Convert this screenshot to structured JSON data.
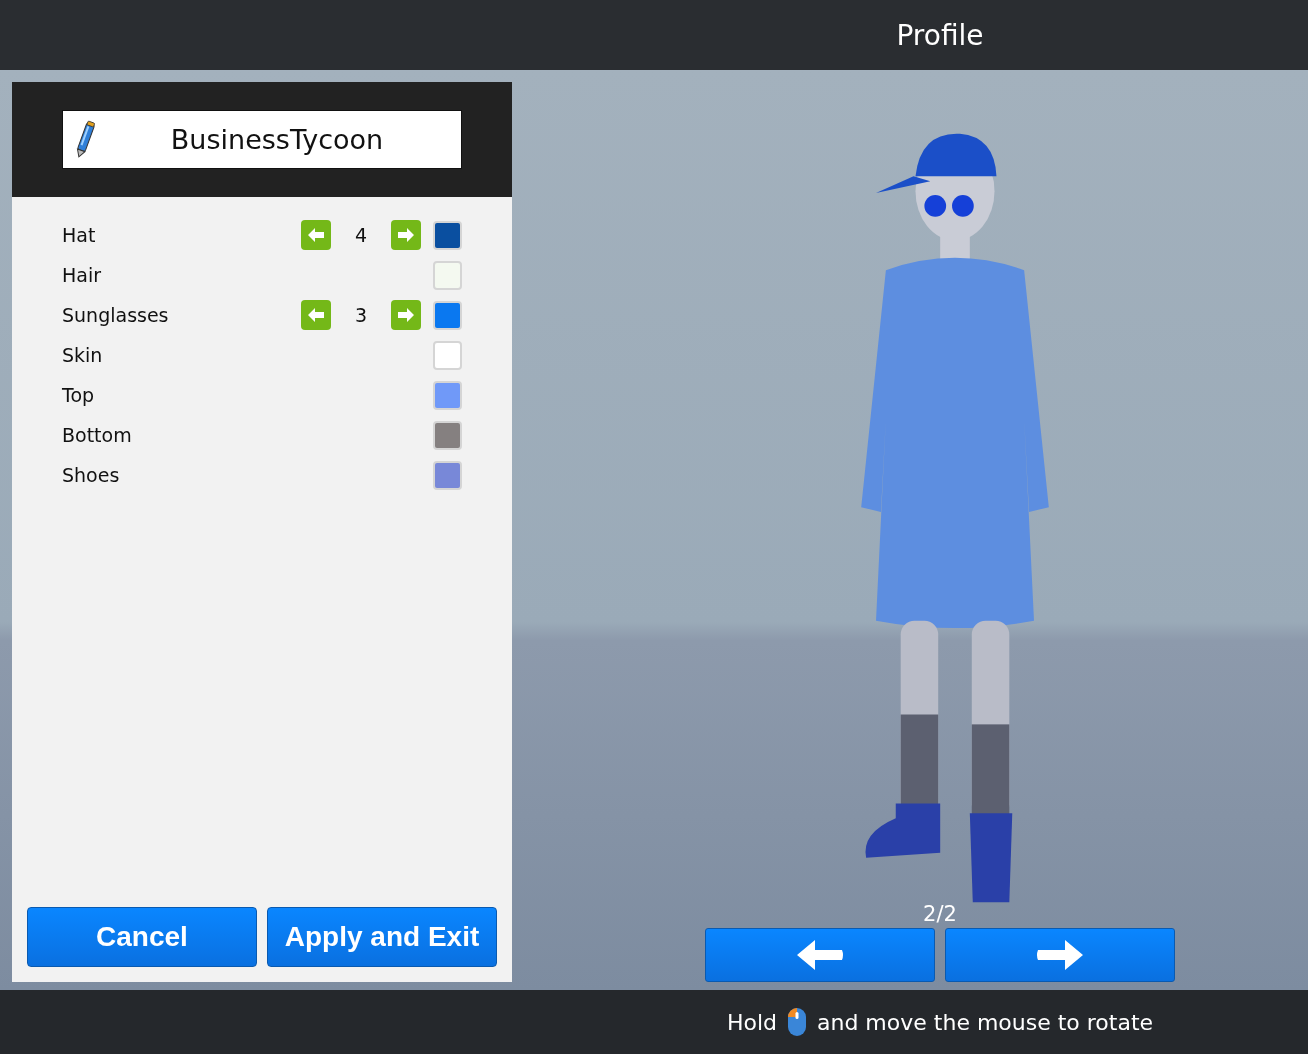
{
  "header": {
    "title": "Profile"
  },
  "panel": {
    "name_field": {
      "value": "BusinessTycoon"
    },
    "items": [
      {
        "kind": "stepper",
        "label": "Hat",
        "value": "4",
        "color": "#0a4fa0"
      },
      {
        "kind": "swatch",
        "label": "Hair",
        "color": "#f4f9f0"
      },
      {
        "kind": "stepper",
        "label": "Sunglasses",
        "value": "3",
        "color": "#0a78f0"
      },
      {
        "kind": "swatch",
        "label": "Skin",
        "color": "#ffffff"
      },
      {
        "kind": "swatch",
        "label": "Top",
        "color": "#7099f8"
      },
      {
        "kind": "swatch",
        "label": "Bottom",
        "color": "#858080"
      },
      {
        "kind": "swatch",
        "label": "Shoes",
        "color": "#7888d8"
      }
    ],
    "buttons": [
      "Cancel",
      "Apply and Exit"
    ]
  },
  "viewer": {
    "page_counter": "2/2"
  },
  "footer": {
    "hint_before": "Hold",
    "hint_after": "and move the mouse to rotate"
  }
}
